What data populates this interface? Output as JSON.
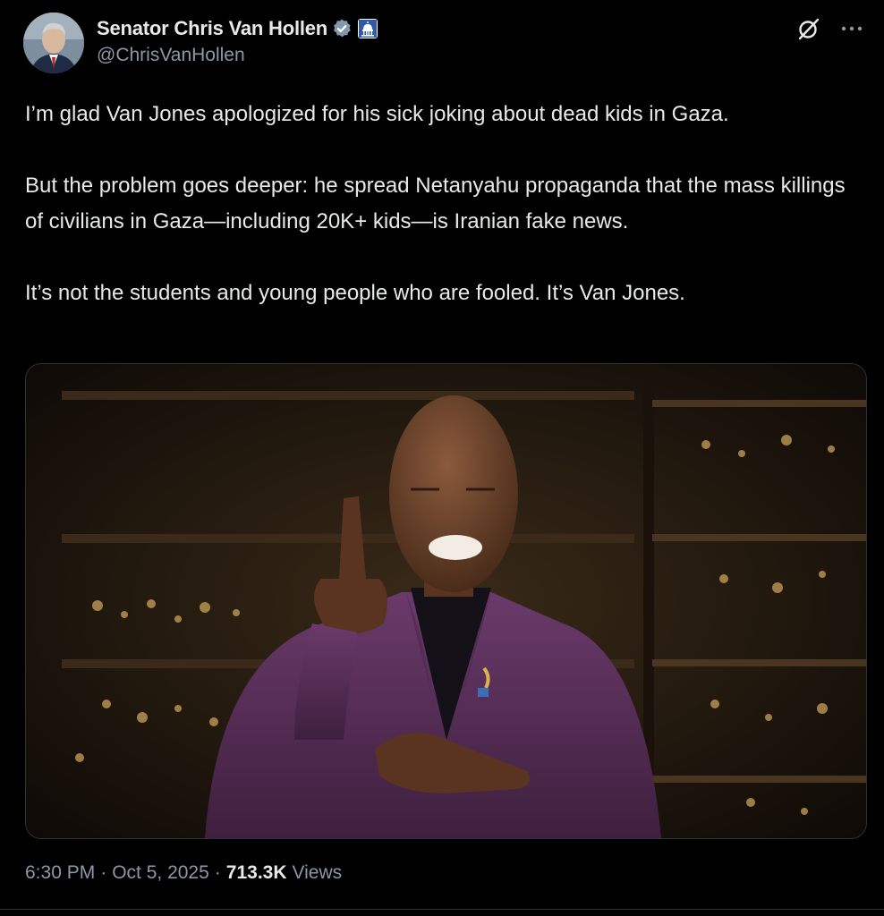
{
  "author": {
    "display_name": "Senator Chris Van Hollen",
    "handle": "@ChrisVanHollen",
    "verified_icon": "verified-badge-icon",
    "affiliation_icon": "capitol-dome-icon"
  },
  "actions": {
    "grok_icon": "grok-icon",
    "more_icon": "more-options-icon"
  },
  "tweet": {
    "paragraphs": [
      "I’m glad Van Jones apologized for his sick joking about dead kids in Gaza.",
      "But the problem goes deeper: he spread Netanyahu propaganda that the mass killings of civilians in Gaza—including 20K+ kids—is Iranian fake news.",
      "It’s not the students and young people who are fooled. It’s Van Jones."
    ]
  },
  "meta": {
    "time": "6:30 PM",
    "separator": "·",
    "date": "Oct 5, 2025",
    "views_count": "713.3K",
    "views_label": "Views"
  },
  "colors": {
    "background": "#000000",
    "text_primary": "#e7e9ea",
    "text_secondary": "#8b98a5",
    "verified_badge": "#829aab",
    "border": "#2f3336"
  }
}
